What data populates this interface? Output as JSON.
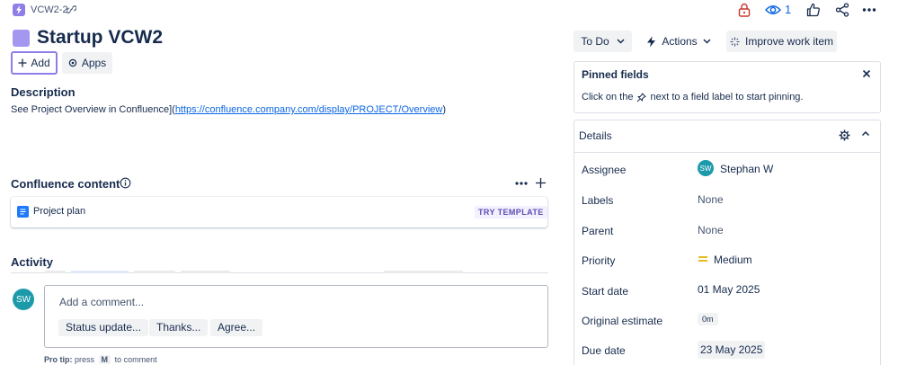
{
  "issue": {
    "key": "VCW2-2",
    "title": "Startup VCW2"
  },
  "toolbar": {
    "add_label": "Add",
    "apps_label": "Apps",
    "watch_count": "1"
  },
  "description": {
    "heading": "Description",
    "text_prefix": "See Project Overview in Confluence](",
    "link": "https://confluence.company.com/display/PROJECT/Overview",
    "text_suffix": ")"
  },
  "confluence": {
    "heading": "Confluence content",
    "item_label": "Project plan",
    "badge": "TRY TEMPLATE"
  },
  "activity": {
    "heading": "Activity",
    "avatar_initials": "SW",
    "comment_placeholder": "Add a comment...",
    "quick_replies": [
      "Status update...",
      "Thanks...",
      "Agree..."
    ],
    "protip_label": "Pro tip:",
    "protip_press": "press",
    "protip_key": "M",
    "protip_suffix": "to comment"
  },
  "status": {
    "current": "To Do",
    "actions_label": "Actions",
    "improve_label": "Improve work item"
  },
  "pinned": {
    "title": "Pinned fields",
    "text_before": "Click on the",
    "text_after": "next to a field label to start pinning."
  },
  "details": {
    "title": "Details",
    "fields": [
      {
        "label": "Assignee",
        "value": "Stephan W",
        "initials": "SW"
      },
      {
        "label": "Labels",
        "value": "None"
      },
      {
        "label": "Parent",
        "value": "None"
      },
      {
        "label": "Priority",
        "value": "Medium"
      },
      {
        "label": "Start date",
        "value": "01 May 2025"
      },
      {
        "label": "Original estimate",
        "value": "0m"
      },
      {
        "label": "Due date",
        "value": "23 May 2025"
      }
    ]
  },
  "colors": {
    "accent": "#8f7ee7",
    "link": "#0c66e4",
    "avatar": "#1d9aaa",
    "lock_red": "#c9372c",
    "priority_orange": "#e2b203"
  }
}
